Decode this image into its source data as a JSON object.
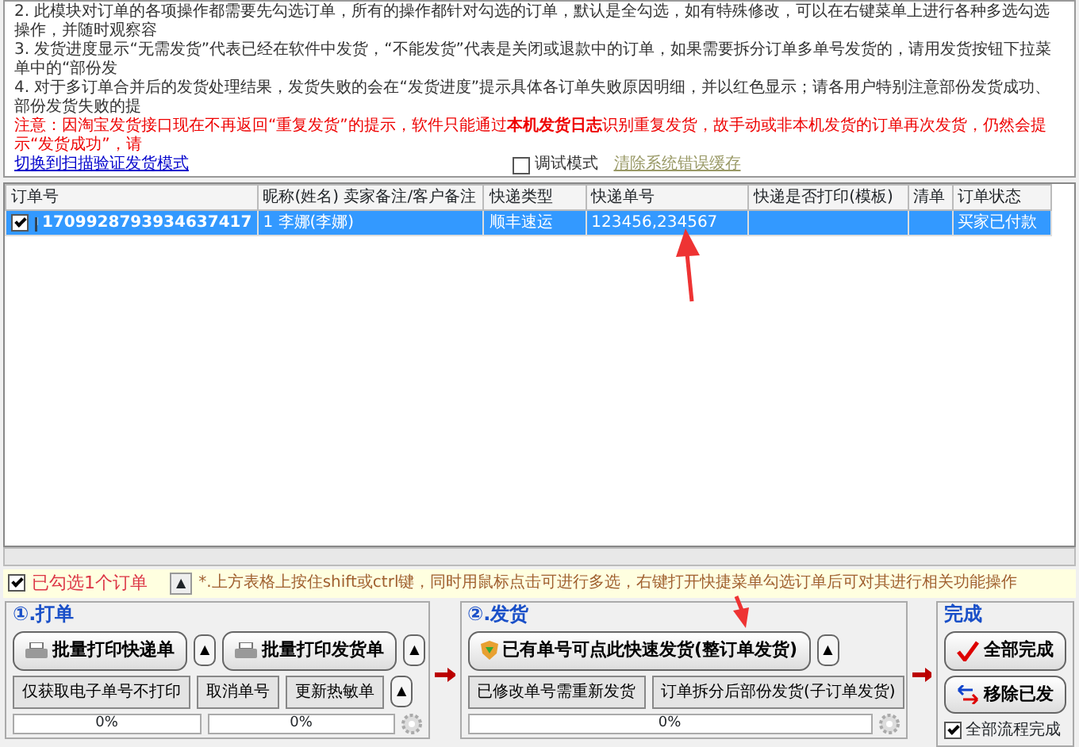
{
  "notice": {
    "lines": [
      "2. 此模块对订单的各项操作都需要先勾选订单，所有的操作都针对勾选的订单，默认是全勾选，如有特殊修改，可以在右键菜单上进行各种多选勾选操作，并随时观察容",
      "3. 发货进度显示“无需发货”代表已经在软件中发货，“不能发货”代表是关闭或退款中的订单，如果需要拆分订单多单号发货的，请用发货按钮下拉菜单中的“部份发",
      "4. 对于多订单合并后的发货处理结果，发货失败的会在“发货进度”提示具体各订单失败原因明细，并以红色显示；请各用户特别注意部份发货成功、部份发货失败的提"
    ],
    "warning": "注意：因淘宝发货接口现在不再返回“重复发货”的提示，软件只能通过**本机发货日志**识别重复发货，故手动或非本机发货的订单再次发货，仍然会提示“发货成功”，请",
    "mode_link": "切换到扫描验证发货模式",
    "debug_mode": {
      "label": "调试模式",
      "checked": false
    },
    "clear_cache_link": "清除系统错误缓存"
  },
  "table": {
    "columns": [
      "订单号",
      "昵称(姓名) 卖家备注/客户备注",
      "快递类型",
      "快递单号",
      "快递是否打印(模板)",
      "清单",
      "订单状态"
    ],
    "rows": [
      {
        "checked": true,
        "selected": true,
        "cells": [
          "1709928793934637417",
          "1 李娜(李娜)",
          "顺丰速运",
          "123456,234567",
          "",
          "",
          "买家已付款"
        ]
      }
    ]
  },
  "status_bar": {
    "selection": {
      "label": "已勾选1个订单",
      "checked": true
    },
    "toggle": "▲",
    "hint": "*.上方表格上按住shift或ctrl键，同时用鼠标点击可进行多选，右键打开快捷菜单勾选订单后可对其进行相关功能操作"
  },
  "groups": [
    {
      "title": "①.打单",
      "primary": [
        {
          "kind": "main",
          "label": "批量打印快递单"
        },
        {
          "kind": "caret",
          "label": "▲"
        },
        {
          "kind": "main",
          "label": "批量打印发货单"
        },
        {
          "kind": "caret",
          "label": "▲"
        }
      ],
      "secondary": [
        {
          "kind": "flat",
          "label": "仅获取电子单号不打印"
        },
        {
          "kind": "flat",
          "label": "取消单号"
        },
        {
          "kind": "flat",
          "label": "更新热敏单"
        },
        {
          "kind": "caret",
          "label": "▲"
        }
      ],
      "progress": [
        {
          "kind": "progress",
          "text": "0%",
          "level": 0
        },
        {
          "kind": "progress",
          "text": "0%",
          "level": 0
        },
        {
          "kind": "gear"
        }
      ]
    },
    {
      "title": "②.发货",
      "primary": [
        {
          "kind": "main",
          "label": "已有单号可点此快速发货(整订单发货)"
        },
        {
          "kind": "caret",
          "label": "▲"
        }
      ],
      "secondary": [
        {
          "kind": "flat",
          "label": "已修改单号需重新发货"
        },
        {
          "kind": "flat",
          "label": "订单拆分后部份发货(子订单发货)"
        }
      ],
      "progress": [
        {
          "kind": "progress",
          "text": "0%",
          "level": 0
        },
        {
          "kind": "gear"
        }
      ]
    },
    {
      "title": "完成",
      "primary": [
        {
          "kind": "main",
          "label": "全部完成"
        }
      ],
      "secondary": [
        {
          "kind": "main",
          "label": "移除已发"
        }
      ],
      "progress": [
        {
          "kind": "checkbox",
          "label": "全部流程完成",
          "checked": true
        }
      ]
    }
  ]
}
